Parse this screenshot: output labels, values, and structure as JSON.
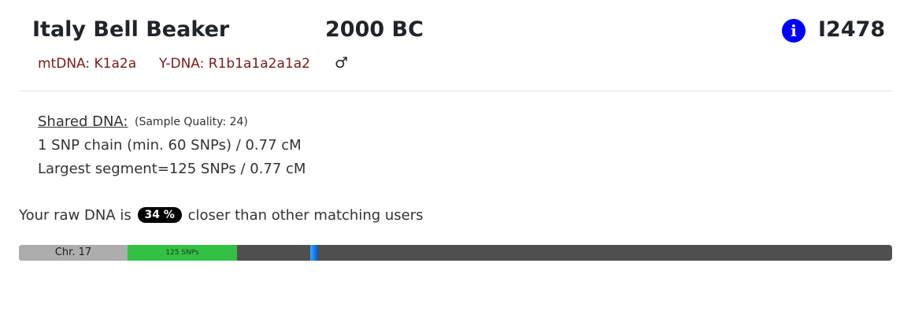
{
  "header": {
    "title": "Italy Bell Beaker",
    "date": "2000 BC",
    "sample_id": "I2478",
    "info_icon": "i",
    "info_icon_color": "#0000ff"
  },
  "haplogroups": {
    "mtdna": "mtDNA: K1a2a",
    "ydna": "Y-DNA: R1b1a1a2a1a2",
    "sex_symbol": "♂",
    "text_color": "#7b1a1a"
  },
  "shared": {
    "label": "Shared DNA:",
    "quality": "(Sample Quality: 24)",
    "line1": "1 SNP chain (min. 60 SNPs) / 0.77 cM",
    "line2": "Largest segment=125 SNPs / 0.77 cM"
  },
  "raw": {
    "prefix": "Your raw DNA is",
    "percent": "34 %",
    "suffix": "closer than other matching users"
  },
  "chromosome": {
    "label": "Chr. 17",
    "segment_label": "125 SNPs",
    "segment_color": "#33c143",
    "bar_color": "#4f4f4f",
    "marker_color": "#1e7be0"
  }
}
